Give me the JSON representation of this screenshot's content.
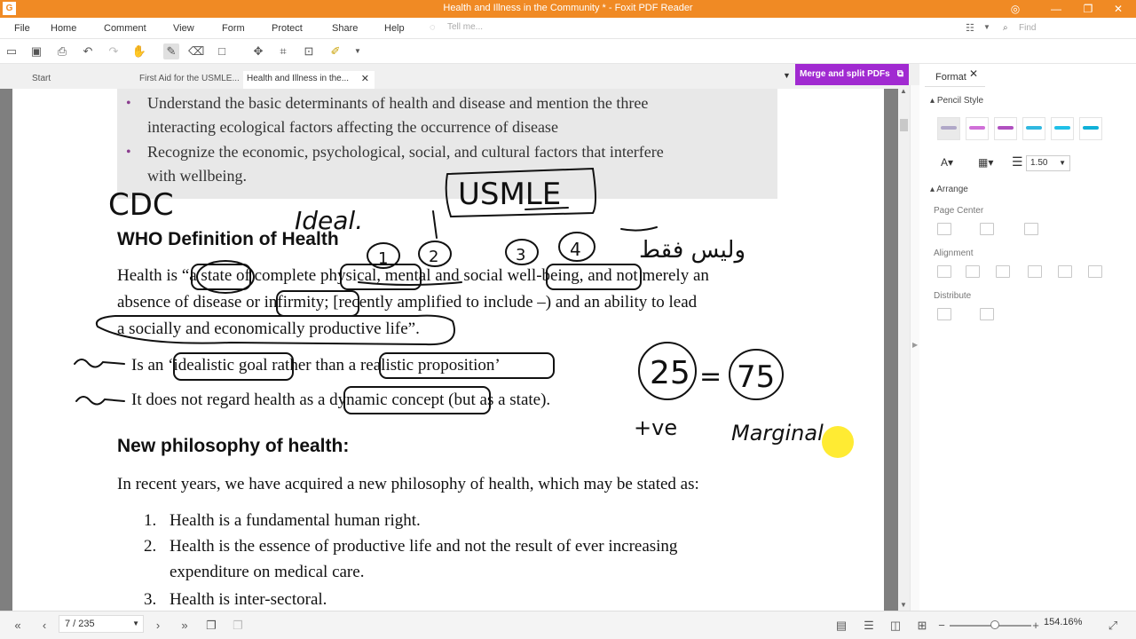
{
  "app": {
    "window_title": "Health and Illness in the Community * - Foxit PDF Reader"
  },
  "menu": [
    "File",
    "Home",
    "Comment",
    "View",
    "Form",
    "Protect",
    "Share",
    "Help"
  ],
  "tell_me_placeholder": "Tell me...",
  "find_placeholder": "Find",
  "tabs": {
    "start": "Start",
    "doc1": "First Aid for the USMLE...",
    "doc2": "Health and Illness in the..."
  },
  "merge_label": "Merge and split PDFs",
  "document": {
    "objectives": [
      "Understand the basic determinants of health and disease and mention the three",
      "interacting ecological factors affecting the occurrence of disease",
      "Recognize the economic, psychological, social, and cultural factors that interfere",
      "with wellbeing."
    ],
    "who_heading": "WHO Definition of Health",
    "health_lines": [
      "Health is “a state of complete physical, mental and social well-being, and not merely an",
      "absence of disease or infirmity; [recently amplified to include –) and an ability to lead",
      "a socially and economically productive life”."
    ],
    "arrow_items": [
      "Is an ‘idealistic goal rather than a realistic proposition’",
      "It does not regard health as a dynamic concept (but as a state)."
    ],
    "philosophy_heading": "New philosophy of health:",
    "philosophy_intro": "In recent years, we have acquired a new philosophy of health, which may be stated as:",
    "numbered": [
      {
        "num": "1.",
        "text": "Health is a fundamental human right."
      },
      {
        "num": "2.",
        "text": "Health is the essence of productive life and not the result of ever increasing"
      },
      {
        "num": "",
        "text": "expenditure on medical care."
      },
      {
        "num": "3.",
        "text": "Health is inter-sectoral."
      }
    ],
    "handwriting": {
      "cdc": "CDC",
      "ideal": "Ideal.",
      "usmle": "USMLE",
      "numbers": [
        "1",
        "2",
        "3",
        "4"
      ],
      "arabic": "وليس فقط",
      "equation_left": "25",
      "equation_sign": "=",
      "equation_right": "75",
      "plus_ve": "+ve",
      "marginal": "Marginal"
    }
  },
  "panel": {
    "tab": "Format",
    "pencil_style": "Pencil Style",
    "line_width": "1.50",
    "arrange": "Arrange",
    "page_center": "Page Center",
    "alignment": "Alignment",
    "distribute": "Distribute",
    "swatch_colors": [
      "#b0a8c8",
      "#d070d8",
      "#b050c0",
      "#30b8e0",
      "#20c0e8",
      "#10b0d8"
    ]
  },
  "status": {
    "page": "7 / 235",
    "zoom": "154.16%"
  }
}
